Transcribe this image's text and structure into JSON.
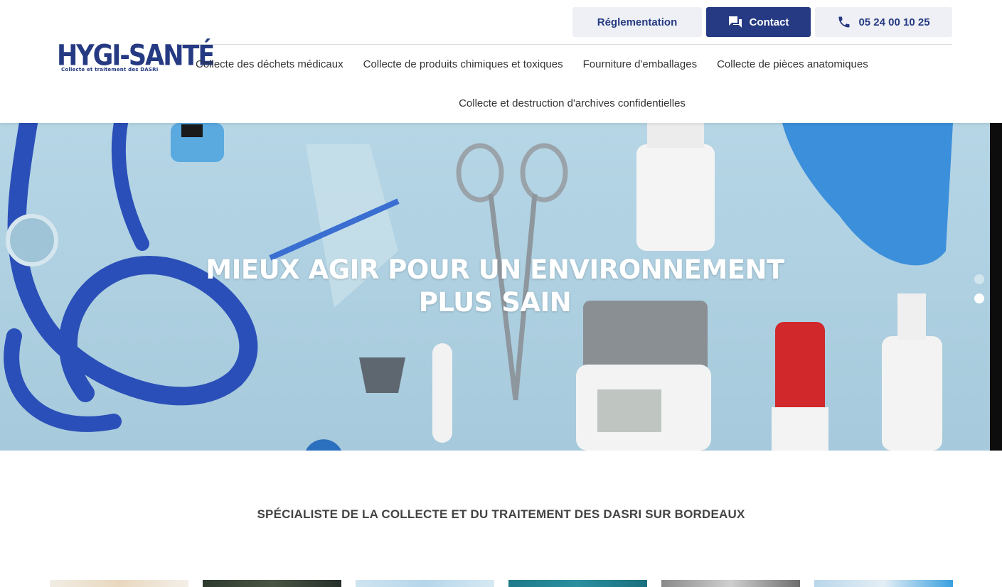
{
  "logo": {
    "main": "HYGI-SANTÉ",
    "sub": "Collecte et traitement des DASRI"
  },
  "top_buttons": {
    "reglementation": "Réglementation",
    "contact": "Contact",
    "phone": "05 24 00 10 25"
  },
  "nav": {
    "items": [
      "Collecte des déchets médicaux",
      "Collecte de produits chimiques et toxiques",
      "Fourniture d'emballages",
      "Collecte de pièces anatomiques",
      "Collecte et destruction d'archives confidentielles"
    ]
  },
  "hero": {
    "title_line1": "MIEUX AGIR POUR UN ENVIRONNEMENT",
    "title_line2": "PLUS SAIN",
    "slide_count": 2,
    "active_slide": 2
  },
  "tagline": "SPÉCIALISTE DE LA COLLECTE ET DU TRAITEMENT DES DASRI SUR BORDEAUX",
  "colors": {
    "brand": "#253a82",
    "hero_background": "#a9cde0",
    "button_light": "#eef0f5"
  }
}
